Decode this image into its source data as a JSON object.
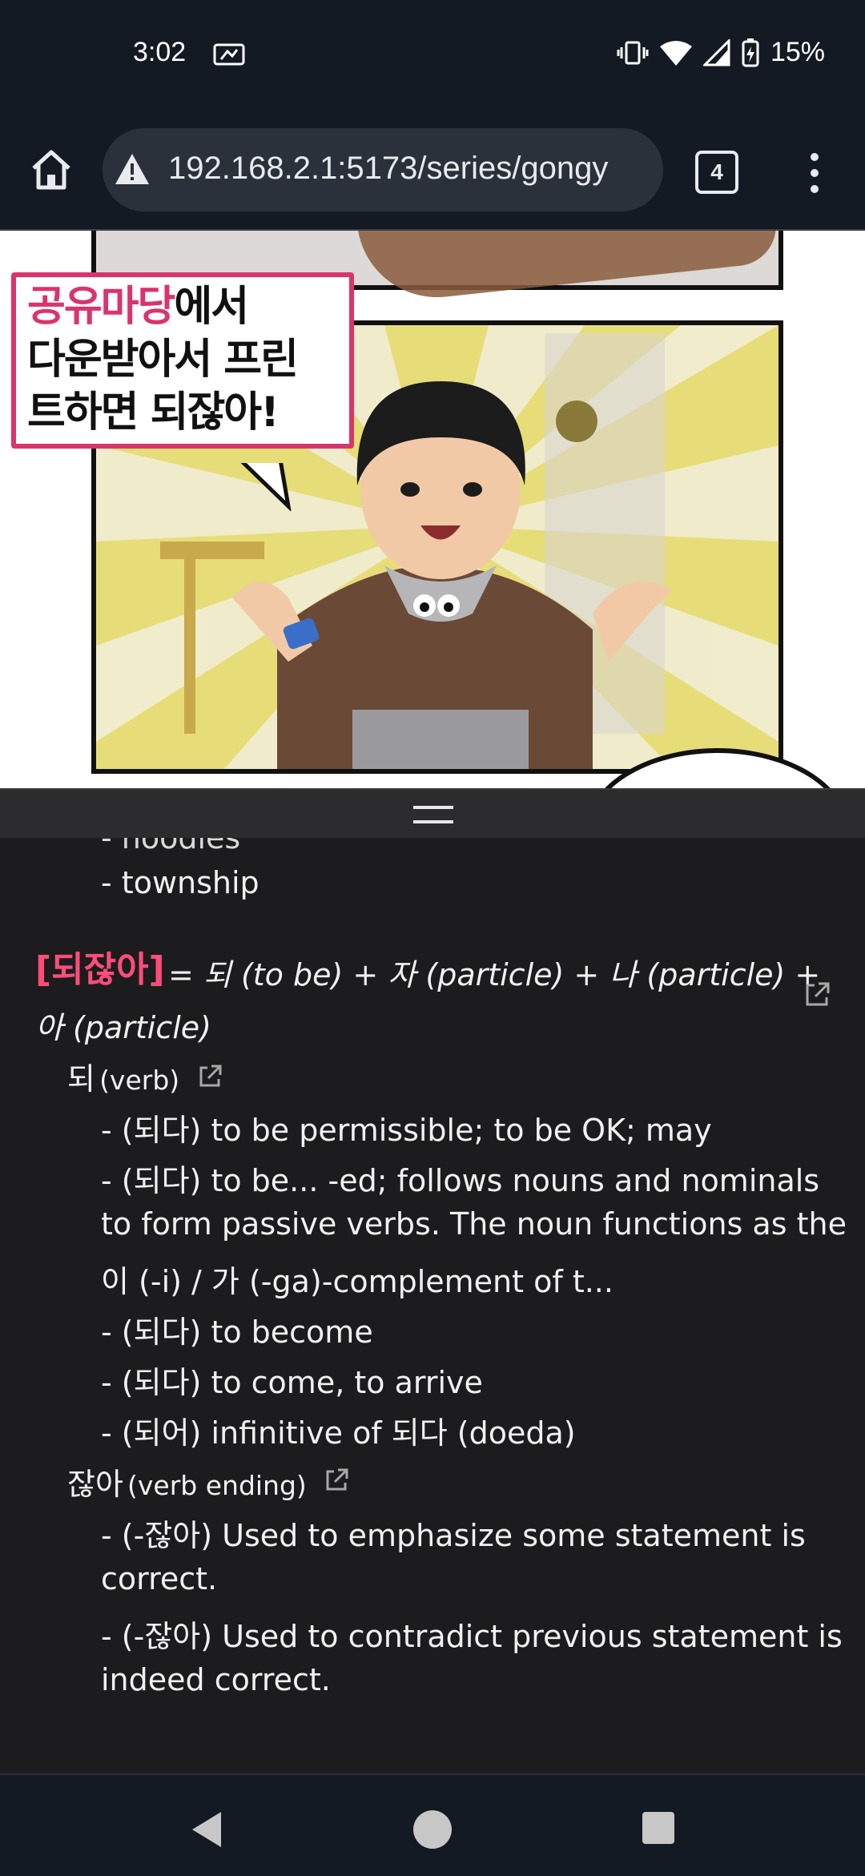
{
  "status_bar": {
    "time": "3:02",
    "battery": "15%"
  },
  "browser": {
    "url": "192.168.2.1:5173/series/gongy",
    "tab_count": "4"
  },
  "comic": {
    "speech_highlight": "공유마당",
    "speech_line1_rest": "에서",
    "speech_line2": "다운받아서 프린",
    "speech_line3": "트하면 되잖아!"
  },
  "dictionary": {
    "partial_previous": "- noodles",
    "prev_item": "- township",
    "word": "[되잖아]",
    "breakdown_line1": "= 되 (to be) + 자 (particle) + 나 (particle) +",
    "breakdown_line2": "아 (particle)",
    "parts": [
      {
        "head": "되",
        "pos": "(verb)",
        "defs": [
          "- (되다) to be permissible; to be OK; may",
          "- (되다) to be... -ed; follows nouns and nominals",
          "to form passive verbs. The noun functions as the",
          "이 (-i) / 가 (-ga)-complement of t...",
          "- (되다) to become",
          "- (되다) to come, to arrive",
          "- (되어) infinitive of 되다 (doeda)"
        ]
      },
      {
        "head": "잖아",
        "pos": "(verb ending)",
        "defs": [
          "- (-잖아) Used to emphasize some statement is",
          "correct.",
          "- (-잖아) Used to contradict previous statement is",
          "indeed correct."
        ]
      }
    ]
  },
  "colors": {
    "accent": "#ff4d7a",
    "bubble_border": "#d9346b",
    "background": "#1c1c1e"
  }
}
